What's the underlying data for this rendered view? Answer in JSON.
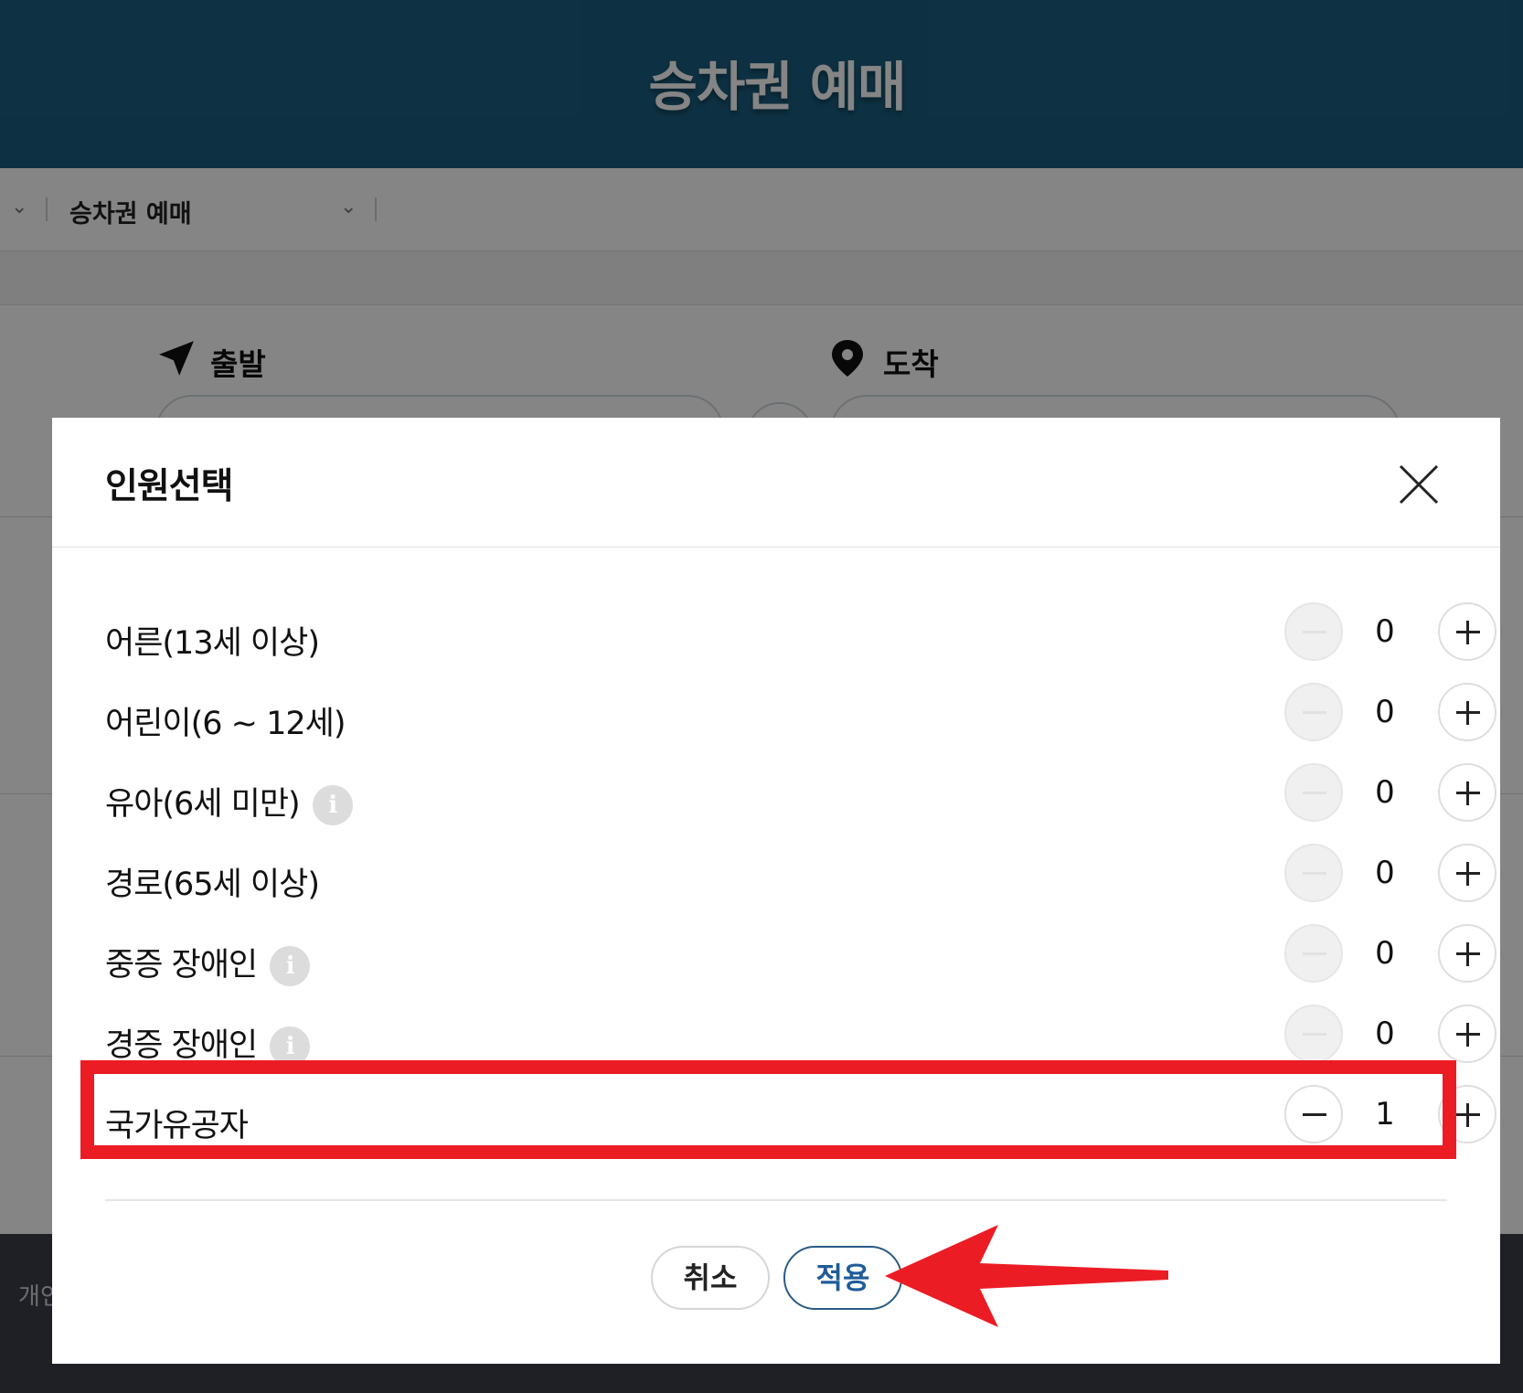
{
  "page": {
    "hero_title": "승차권 예매",
    "breadcrumb": {
      "current": "승차권 예매"
    },
    "route": {
      "departure_label": "출발",
      "arrival_label": "도착"
    },
    "footer_text": "개인"
  },
  "modal": {
    "title": "인원선택",
    "rows": [
      {
        "label": "어른(13세 이상)",
        "count": "0",
        "info": false
      },
      {
        "label": "어린이(6 ~ 12세)",
        "count": "0",
        "info": false
      },
      {
        "label": "유아(6세 미만)",
        "count": "0",
        "info": true
      },
      {
        "label": "경로(65세 이상)",
        "count": "0",
        "info": false
      },
      {
        "label": "중증 장애인",
        "count": "0",
        "info": true
      },
      {
        "label": "경증 장애인",
        "count": "0",
        "info": true
      },
      {
        "label": "국가유공자",
        "count": "1",
        "info": false
      }
    ],
    "info_glyph": "i",
    "cancel_label": "취소",
    "apply_label": "적용"
  },
  "annotation": {
    "highlight_color": "#ec1c24",
    "arrow_color": "#ec1c24"
  }
}
